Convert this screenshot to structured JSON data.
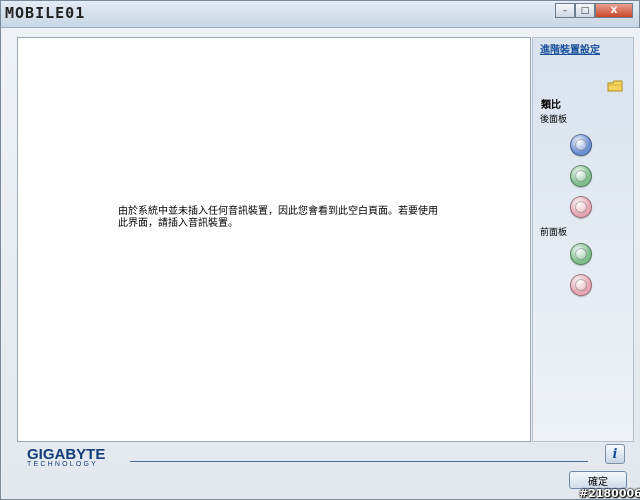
{
  "window": {
    "brand": "MOBILE01",
    "buttons": {
      "minimize": "–",
      "maximize": "□",
      "close": "X"
    }
  },
  "main": {
    "message": "由於系統中並未插入任何音訊裝置，因此您會看到此空白頁面。若要使用此界面，請插入音訊裝置。"
  },
  "side": {
    "advanced_link": "進階裝置設定",
    "analog_title": "類比",
    "rear_label": "後面板",
    "front_label": "前面板",
    "rear_jacks": [
      {
        "color": "#6c8fd4"
      },
      {
        "color": "#7fbf8c"
      },
      {
        "color": "#e5a5b4"
      }
    ],
    "front_jacks": [
      {
        "color": "#7fbf8c"
      },
      {
        "color": "#e5a5b4"
      }
    ]
  },
  "footer": {
    "logo_main": "GIGABYTE",
    "logo_sub": "TECHNOLOGY",
    "info": "i",
    "ok_label": "確定"
  },
  "watermark": "#2180006"
}
